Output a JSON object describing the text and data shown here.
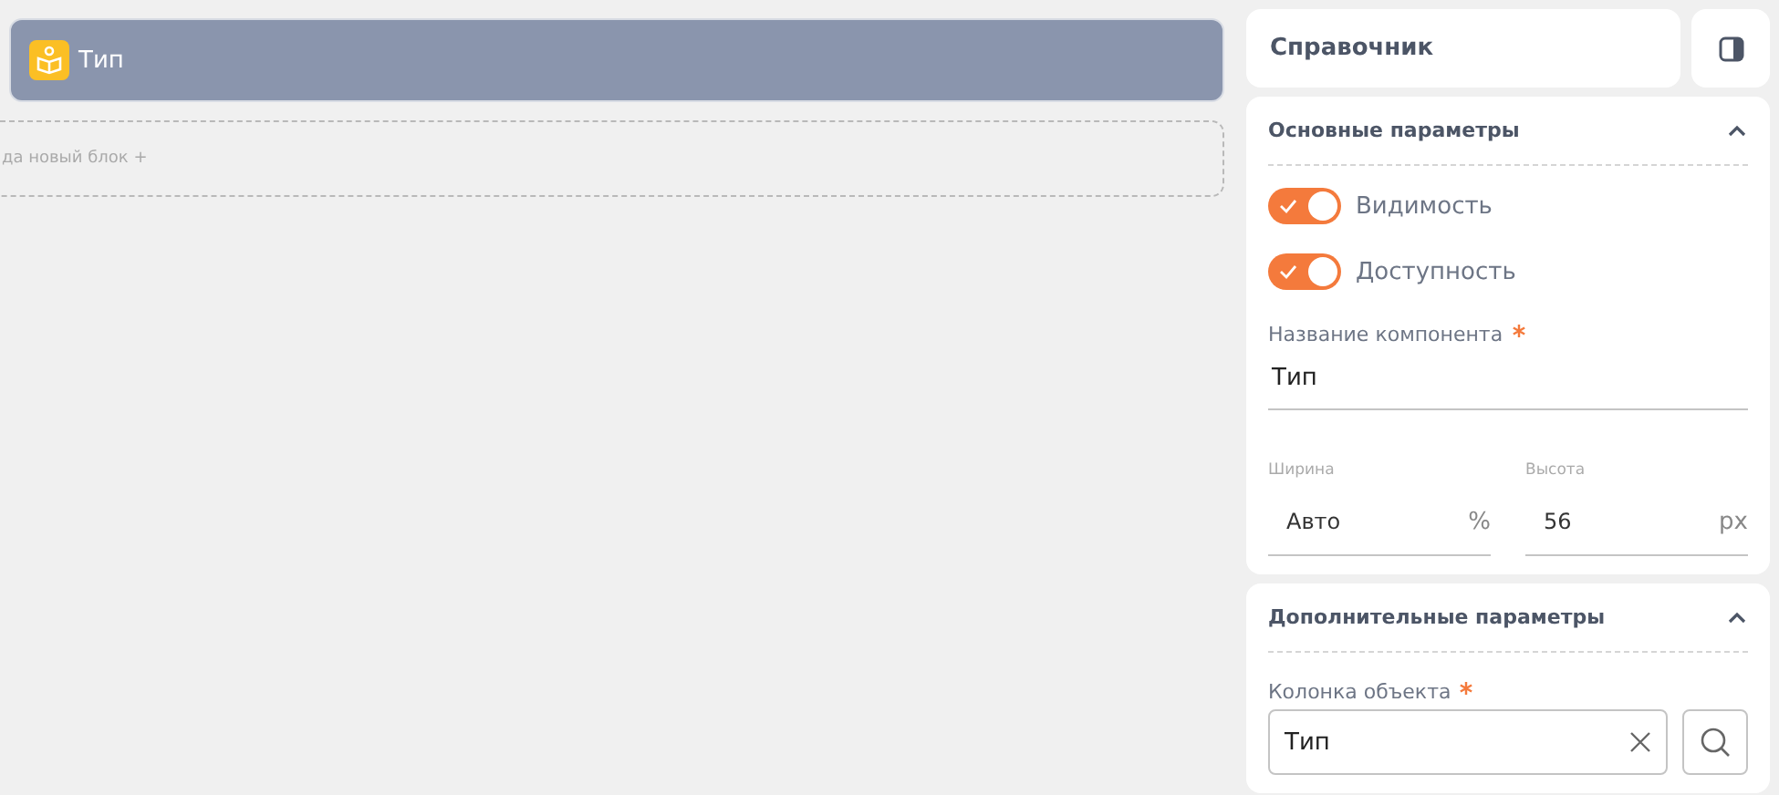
{
  "canvas": {
    "block": {
      "label": "Тип"
    },
    "dropzone": {
      "label": "да новый блок +"
    }
  },
  "panel": {
    "title": "Справочник",
    "main_section": {
      "title": "Основные параметры",
      "expanded": true,
      "toggles": [
        {
          "label": "Видимость",
          "on": true
        },
        {
          "label": "Доступность",
          "on": true
        }
      ],
      "name_field": {
        "label": "Название компонента",
        "required": true,
        "value": "Тип"
      },
      "size_fields": [
        {
          "label": "Ширина",
          "value": "Авто",
          "unit": "%"
        },
        {
          "label": "Высота",
          "value": "56",
          "unit": "px"
        }
      ]
    },
    "extra_section": {
      "title": "Дополнительные параметры",
      "expanded": true,
      "column_field": {
        "label": "Колонка объекта",
        "required": true,
        "value": "Тип"
      }
    }
  }
}
